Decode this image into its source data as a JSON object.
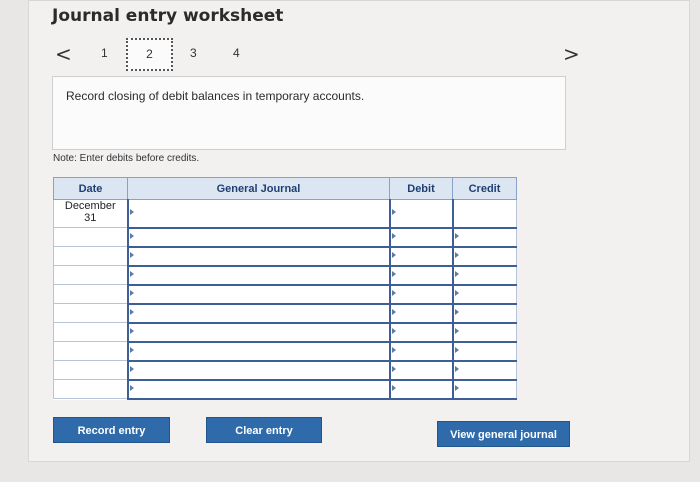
{
  "title": "Journal entry worksheet",
  "pager": {
    "prev": "<",
    "next": ">",
    "steps": [
      "1",
      "2",
      "3",
      "4"
    ],
    "current": "2"
  },
  "instruction": "Record closing of debit balances in temporary accounts.",
  "note": "Note: Enter debits before credits.",
  "table": {
    "headers": {
      "date": "Date",
      "journal": "General Journal",
      "debit": "Debit",
      "credit": "Credit"
    },
    "first_date_line1": "December",
    "first_date_line2": "31"
  },
  "buttons": {
    "record": "Record entry",
    "clear": "Clear entry",
    "view": "View general journal"
  }
}
